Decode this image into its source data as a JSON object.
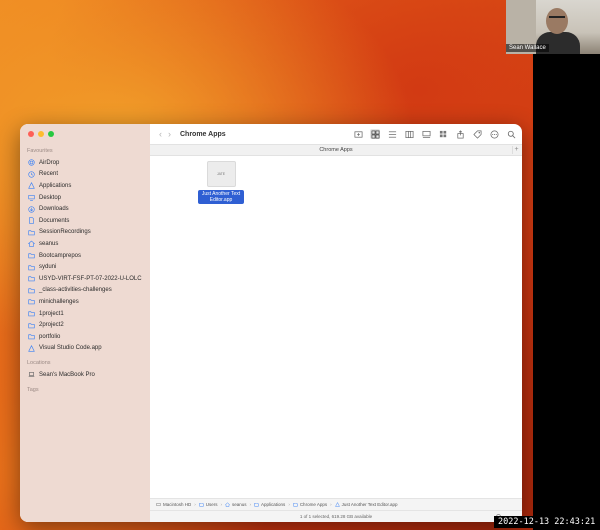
{
  "video": {
    "participant_name": "Sean Wallace",
    "timestamp": "2022-12-13 22:43:21"
  },
  "finder": {
    "title": "Chrome Apps",
    "path_header": "Chrome Apps",
    "sidebar": {
      "favourites_title": "Favourites",
      "favourites": [
        {
          "label": "AirDrop",
          "icon": "airdrop-icon"
        },
        {
          "label": "Recent",
          "icon": "clock-icon"
        },
        {
          "label": "Applications",
          "icon": "applications-icon"
        },
        {
          "label": "Desktop",
          "icon": "desktop-icon"
        },
        {
          "label": "Downloads",
          "icon": "download-icon"
        },
        {
          "label": "Documents",
          "icon": "document-icon"
        },
        {
          "label": "SessionRecordings",
          "icon": "folder-icon"
        },
        {
          "label": "seanus",
          "icon": "home-icon"
        },
        {
          "label": "Bootcamprepos",
          "icon": "folder-icon"
        },
        {
          "label": "syduni",
          "icon": "folder-icon"
        },
        {
          "label": "USYD-VIRT-FSF-PT-07-2022-U-LOLC",
          "icon": "folder-icon"
        },
        {
          "label": "_class-activities-challenges",
          "icon": "folder-icon"
        },
        {
          "label": "minichallenges",
          "icon": "folder-icon"
        },
        {
          "label": "1project1",
          "icon": "folder-icon"
        },
        {
          "label": "2project2",
          "icon": "folder-icon"
        },
        {
          "label": "portfolio",
          "icon": "folder-icon"
        },
        {
          "label": "Visual Studio Code.app",
          "icon": "app-icon"
        }
      ],
      "locations_title": "Locations",
      "locations": [
        {
          "label": "Sean's MacBook Pro",
          "icon": "laptop-icon"
        }
      ],
      "tags_title": "Tags"
    },
    "files": [
      {
        "name": "Just Another Text Editor.app",
        "thumb_text": "JATE",
        "selected": true
      }
    ],
    "pathbar": [
      {
        "label": "Macintosh HD",
        "icon": "drive-icon"
      },
      {
        "label": "Users",
        "icon": "folder-icon"
      },
      {
        "label": "seanus",
        "icon": "home-icon"
      },
      {
        "label": "Applications",
        "icon": "folder-icon"
      },
      {
        "label": "Chrome Apps",
        "icon": "folder-icon"
      },
      {
        "label": "Just Another Text Editor.app",
        "icon": "app-icon"
      }
    ],
    "status": "1 of 1 selected, 619.28 GB available",
    "icon_size_fraction": 0.1
  },
  "colors": {
    "selection": "#2f5fd3",
    "sidebar_bg": "#eedad2",
    "folder_blue": "#4a90d9"
  }
}
